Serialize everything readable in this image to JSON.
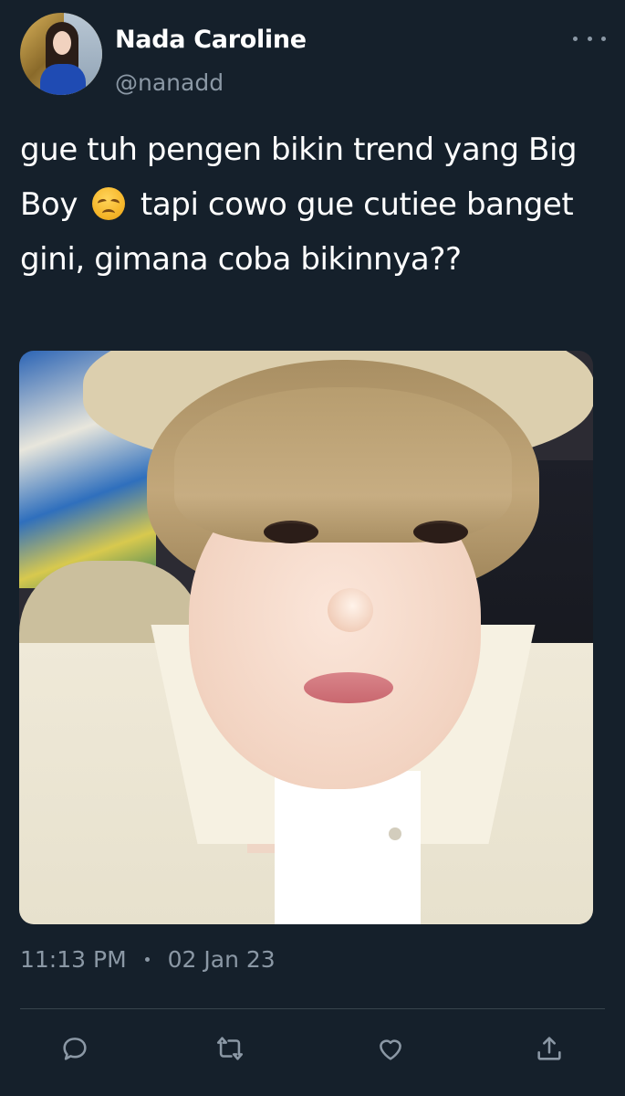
{
  "author": {
    "display_name": "Nada Caroline",
    "handle": "@nanadd",
    "avatar_icon": "avatar"
  },
  "tweet": {
    "text_part1": "gue tuh pengen bikin trend yang Big Boy",
    "emoji": "disappointed-face-emoji",
    "text_part2": "tapi cowo gue cutiee banget gini, gimana coba bikinnya??",
    "image": "photo-of-person"
  },
  "meta": {
    "time": "11:13 PM",
    "date": "02 Jan 23"
  },
  "actions": {
    "reply_icon": "reply-icon",
    "retweet_icon": "retweet-icon",
    "like_icon": "heart-icon",
    "share_icon": "share-icon"
  },
  "colors": {
    "background": "#15202b",
    "primary_text": "#ffffff",
    "secondary_text": "#8b98a5",
    "divider": "#38444d"
  }
}
